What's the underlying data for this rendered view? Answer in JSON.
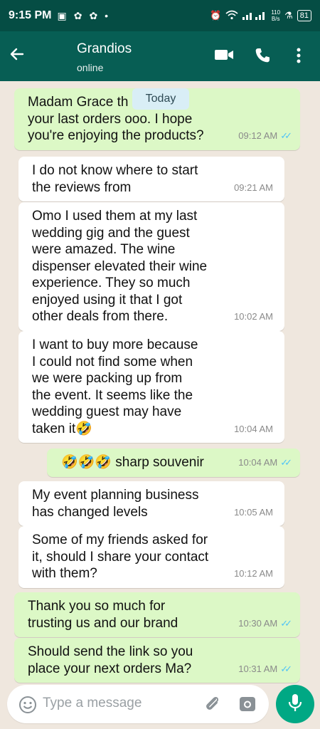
{
  "status_bar": {
    "time": "9:15 PM",
    "speed_value": "110",
    "speed_unit": "B/s",
    "battery": "81"
  },
  "header": {
    "contact_name": "Grandios",
    "status": "online"
  },
  "date_chip": "Today",
  "messages": [
    {
      "dir": "out",
      "text": "Madam Grace th      or\nyour last orders ooo. I hope\nyou're enjoying the products?",
      "time": "09:12 AM",
      "ticks": "✓✓"
    },
    {
      "dir": "in",
      "text": "I do not know where to start\nthe reviews from",
      "time": "09:21 AM"
    },
    {
      "dir": "in",
      "text": "Omo I used them at my last\nwedding gig and the guest\nwere amazed. The wine\ndispenser elevated their wine\nexperience. They so much\nenjoyed using it that I got\nother deals from there.",
      "time": "10:02 AM"
    },
    {
      "dir": "in",
      "text": "I want to buy more because\nI could not find some when\nwe were packing up from\nthe event. It seems like the\nwedding guest may have\ntaken it🤣",
      "time": "10:04 AM"
    },
    {
      "dir": "out",
      "text": "🤣🤣🤣 sharp souvenir",
      "time": "10:04 AM",
      "ticks": "✓✓"
    },
    {
      "dir": "in",
      "text": "My event planning business\nhas changed levels",
      "time": "10:05 AM"
    },
    {
      "dir": "in",
      "text": "Some of my friends asked for\nit, should I share your contact\nwith them?",
      "time": "10:12 AM"
    },
    {
      "dir": "out",
      "text": "Thank you so much for\ntrusting us and our brand",
      "time": "10:30 AM",
      "ticks": "✓✓"
    },
    {
      "dir": "out",
      "text": "Should send the link so you\nplace your next orders Ma?",
      "time": "10:31 AM",
      "ticks": "✓✓"
    }
  ],
  "composer": {
    "placeholder": "Type a message"
  },
  "colors": {
    "header": "#075e54",
    "statusbar": "#054d44",
    "outgoing_bubble": "#dcf8c6",
    "incoming_bubble": "#ffffff",
    "read_ticks": "#4fc3f7",
    "mic_button": "#00a884"
  },
  "icons": [
    "back-arrow-icon",
    "video-call-icon",
    "voice-call-icon",
    "more-options-icon",
    "emoji-icon",
    "attach-icon",
    "camera-icon",
    "mic-icon"
  ]
}
